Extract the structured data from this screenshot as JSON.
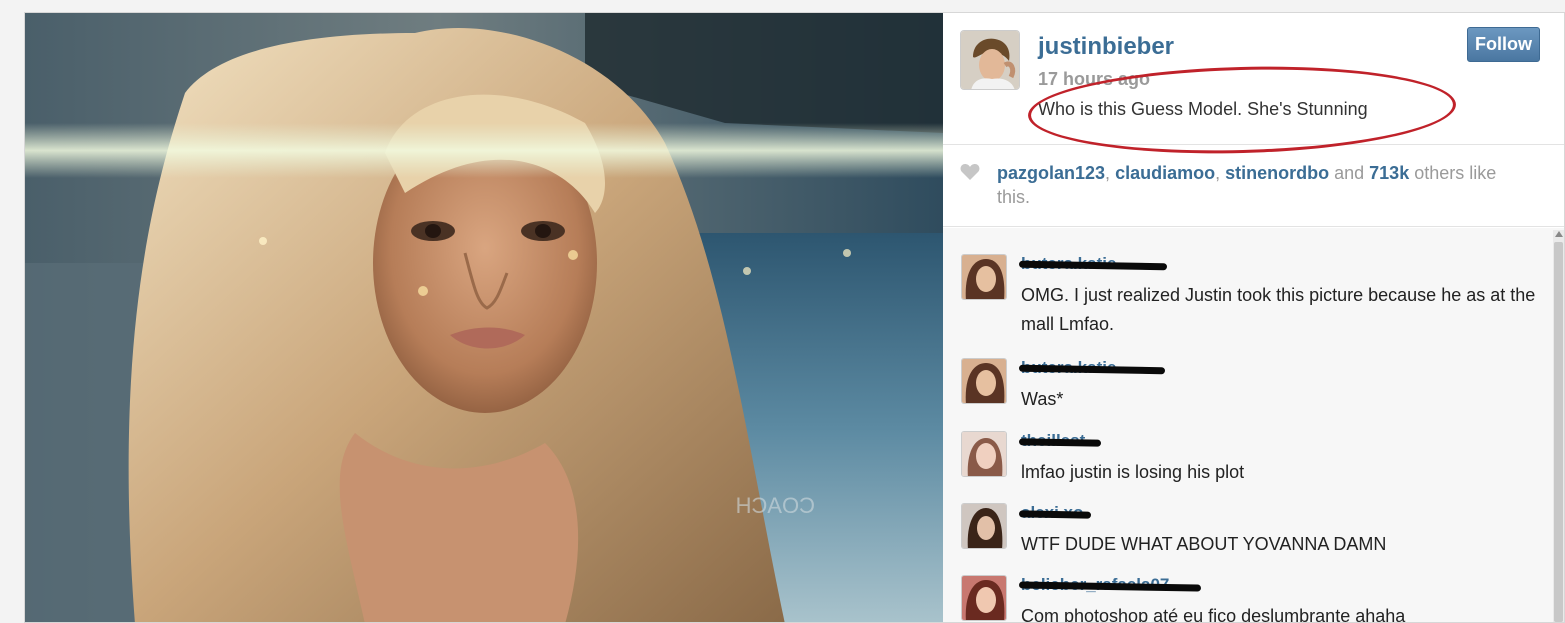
{
  "post": {
    "username": "justinbieber",
    "time_ago": "17 hours ago",
    "caption": "Who is this Guess Model. She's Stunning",
    "follow_label": "Follow",
    "photo_watermark": "COACH"
  },
  "likes": {
    "users": [
      "pazgolan123",
      "claudiamoo",
      "stinenordbo"
    ],
    "sep1": ", ",
    "sep2": ", ",
    "and_word": " and ",
    "count": "713k",
    "suffix": " others like this."
  },
  "comments": [
    {
      "username": "butera.katie",
      "text": "OMG. I just realized Justin took this picture because he as at the mall Lmfao.",
      "avatar_color": "#8a5a40"
    },
    {
      "username": "butera.katie",
      "text": "Was*",
      "avatar_color": "#8a5a40"
    },
    {
      "username": "theillest",
      "text": "lmfao justin is losing his plot",
      "avatar_color": "#c89a8a"
    },
    {
      "username": "alexi.xo",
      "text": "WTF DUDE WHAT ABOUT YOVANNA DAMN",
      "avatar_color": "#6a4a3a"
    },
    {
      "username": "belieber_rafaela07",
      "text": "Com photoshop até eu fico deslumbrante ahaha",
      "avatar_color": "#a0504a"
    }
  ],
  "colors": {
    "link_blue": "#3b6d95",
    "follow_button": "#5b87b0",
    "annotation_red": "#c0222a",
    "muted_gray": "#9a9a9a"
  }
}
